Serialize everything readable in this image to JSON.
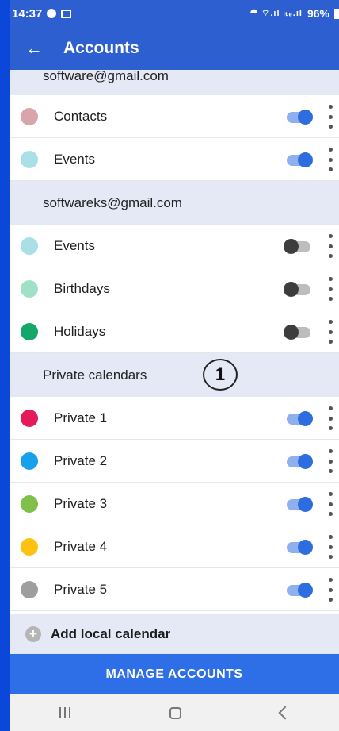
{
  "status_bar": {
    "time": "14:37",
    "battery": "96%",
    "signal": "⯊ ⌔.ıl ₗₜₑ.ıl"
  },
  "app_bar": {
    "back_icon": "arrow-left-icon",
    "title": "Accounts"
  },
  "sections": [
    {
      "header": "software@gmail.com",
      "first": true,
      "rows": [
        {
          "label": "Contacts",
          "color": "#d9a5ac",
          "enabled": true
        },
        {
          "label": "Events",
          "color": "#a8e0e6",
          "enabled": true
        }
      ]
    },
    {
      "header": "softwareks@gmail.com",
      "rows": [
        {
          "label": "Events",
          "color": "#a8e0e6",
          "enabled": false
        },
        {
          "label": "Birthdays",
          "color": "#9fe0c6",
          "enabled": false
        },
        {
          "label": "Holidays",
          "color": "#14a76a",
          "enabled": false
        }
      ]
    },
    {
      "header": "Private calendars",
      "rows": [
        {
          "label": "Private 1",
          "color": "#e31b5a",
          "enabled": true
        },
        {
          "label": "Private 2",
          "color": "#17a1ec",
          "enabled": true
        },
        {
          "label": "Private 3",
          "color": "#7fc04a",
          "enabled": true
        },
        {
          "label": "Private 4",
          "color": "#fdc112",
          "enabled": true
        },
        {
          "label": "Private 5",
          "color": "#9e9e9e",
          "enabled": true
        }
      ]
    }
  ],
  "annotation_badge": "1",
  "add_local_calendar": "Add local calendar",
  "manage_accounts": "MANAGE ACCOUNTS",
  "colors": {
    "app_bar": "#2e5fd1",
    "manage_button": "#2e6ee6",
    "section_bg": "#e5e9f6"
  }
}
